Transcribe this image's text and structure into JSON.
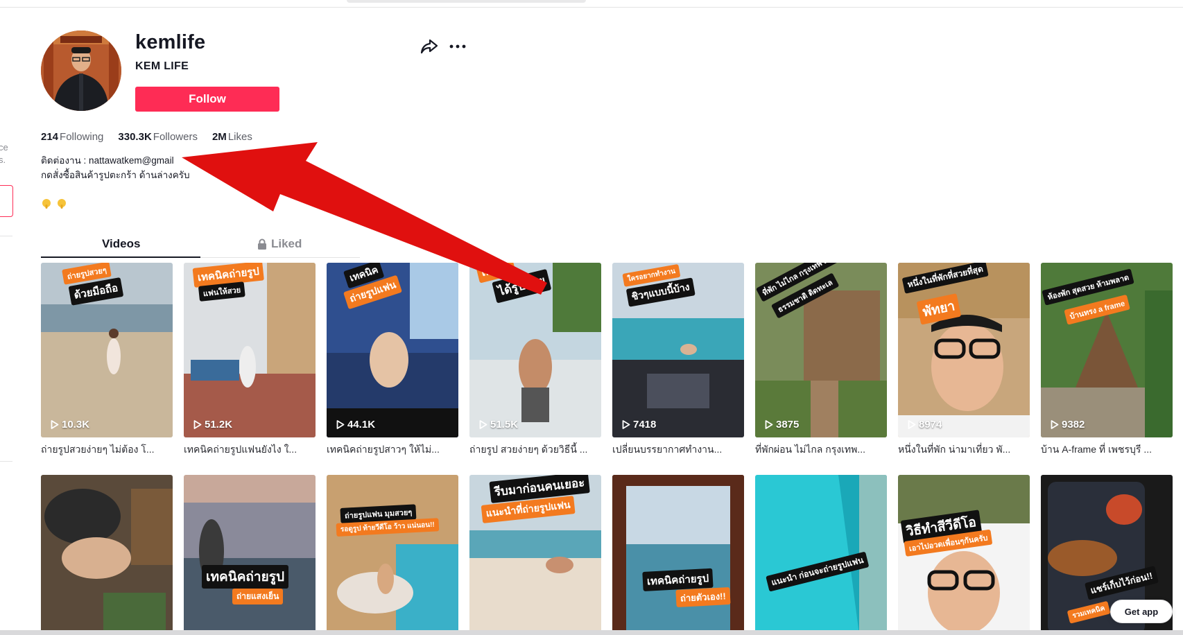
{
  "profile": {
    "username": "kemlife",
    "nickname": "KEM LIFE",
    "follow_label": "Follow",
    "stats": [
      {
        "count": "214",
        "label": "Following"
      },
      {
        "count": "330.3K",
        "label": "Followers"
      },
      {
        "count": "2M",
        "label": "Likes"
      }
    ],
    "bio_line1": "ติดต่องาน : nattawatkem@gmail",
    "bio_line2": "กดสั่งซื้อสินค้ารูปตะกร้า ด้านล่างครับ",
    "emojis": [
      "point-down-emoji",
      "point-down-emoji"
    ]
  },
  "tabs": {
    "videos": "Videos",
    "liked": "Liked"
  },
  "videos": [
    {
      "views": "10.3K",
      "caption": "ถ่ายรูปสวยง่ายๆ ไม่ต้อง โ...",
      "badges": [
        "ถ่ายรูปสวยๆ",
        "ด้วยมือถือ"
      ]
    },
    {
      "views": "51.2K",
      "caption": "เทคนิคถ่ายรูปแฟนยังไง ใ...",
      "badges": [
        "เทคนิคถ่ายรูป",
        "แฟนให้สวย"
      ]
    },
    {
      "views": "44.1K",
      "caption": "เทคนิคถ่ายรูปสาวๆ ให้ไม่...",
      "badges": [
        "เทคนิค",
        "ถ่ายรูปแฟน"
      ]
    },
    {
      "views": "51.5K",
      "caption": "ถ่ายรูป สวยง่ายๆ ด้วยวิธีนี้ ...",
      "badges": [
        "เทคนิค",
        "ได้รูปสวย"
      ]
    },
    {
      "views": "7418",
      "caption": "เปลี่ยนบรรยากาศทำงาน...",
      "badges": [
        "ใครอยากทำงาน",
        "ชิวๆแบบนี้บ้าง"
      ]
    },
    {
      "views": "3875",
      "caption": "ที่พักผ่อน ไม่ไกล กรุงเทพ...",
      "badges": [
        "ที่พัก ไม่ไกล กรุงเทพ เน้น",
        "ธรรมชาติ ติดทะเล"
      ]
    },
    {
      "views": "8974",
      "caption": "หนึ่งในที่พัก น่ามาเที่ยว พั...",
      "badges": [
        "หนึ่งในที่พักที่สวยที่สุด",
        "พัทยา"
      ]
    },
    {
      "views": "9382",
      "caption": "บ้าน A-frame ที่ เพชรบุรี ...",
      "badges": [
        "ห้องพัก สุดสวย ห้ามพลาด",
        "บ้านทรง a frame"
      ]
    }
  ],
  "videos_row2": [
    {
      "badges": []
    },
    {
      "badges": [
        "เทคนิคถ่ายรูป",
        "ถ่ายแสงเย็น"
      ]
    },
    {
      "badges": [
        "ถ่ายรูปแฟน มุมสวยๆ",
        "รอดูรูป ท้ายวีดีโอ ว้าว แน่นอน!!"
      ]
    },
    {
      "badges": [
        "รีบมาก่อนคนเยอะ",
        "แนะนำที่ถ่ายรูปแฟน"
      ]
    },
    {
      "badges": [
        "เทคนิคถ่ายรูป",
        "ถ่ายตัวเอง!!"
      ]
    },
    {
      "badges": [
        "แนะนำ ก่อนจะถ่ายรูปแฟน"
      ]
    },
    {
      "badges": [
        "วิธีทำสีวีดีโอ",
        "เอาไปอวดเพื่อนๆกันครับ"
      ]
    },
    {
      "badges": [
        "แชร์เก็บไว้ก่อน!!",
        "รวมเทคนิค"
      ]
    }
  ],
  "get_app_label": "Get app",
  "colors": {
    "brand": "#fe2c55",
    "annotation_arrow": "#e0100f",
    "badge_orange": "#f37a1f"
  },
  "icons": [
    "share-icon",
    "more-icon",
    "lock-icon",
    "play-icon"
  ]
}
